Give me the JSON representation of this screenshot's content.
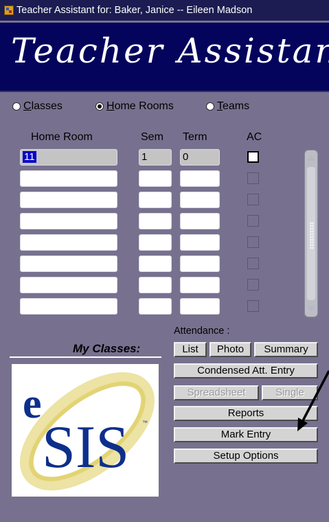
{
  "window": {
    "title": "Teacher Assistant for: Baker, Janice -- Eileen Madson"
  },
  "banner": {
    "text": "Teacher Assistant"
  },
  "view_options": [
    {
      "label": "Classes",
      "selected": false
    },
    {
      "label": "Home Rooms",
      "selected": true
    },
    {
      "label": "Teams",
      "selected": false
    }
  ],
  "table": {
    "headers": {
      "home_room": "Home Room",
      "sem": "Sem",
      "term": "Term",
      "ac": "AC"
    },
    "rows": [
      {
        "home_room": "11",
        "sem": "1",
        "term": "0",
        "ac": false
      },
      {
        "home_room": "",
        "sem": "",
        "term": "",
        "ac": false
      },
      {
        "home_room": "",
        "sem": "",
        "term": "",
        "ac": false
      },
      {
        "home_room": "",
        "sem": "",
        "term": "",
        "ac": false
      },
      {
        "home_room": "",
        "sem": "",
        "term": "",
        "ac": false
      },
      {
        "home_room": "",
        "sem": "",
        "term": "",
        "ac": false
      },
      {
        "home_room": "",
        "sem": "",
        "term": "",
        "ac": false
      },
      {
        "home_room": "",
        "sem": "",
        "term": "",
        "ac": false
      }
    ]
  },
  "attendance": {
    "label": "Attendance :",
    "list": "List",
    "photo": "Photo",
    "summary": "Summary",
    "condensed": "Condensed Att. Entry",
    "spreadsheet": "Spreadsheet",
    "single": "Single"
  },
  "buttons": {
    "reports": "Reports",
    "mark_entry": "Mark Entry",
    "setup_options": "Setup Options"
  },
  "my_classes": "My Classes:",
  "logo": {
    "letter": "e",
    "text": "SIS",
    "tm": "™"
  },
  "colors": {
    "window_bg": "#77718f",
    "banner_bg": "#04045c",
    "logo_blue": "#0d2f8c",
    "logo_gold": "#e6d36a"
  }
}
